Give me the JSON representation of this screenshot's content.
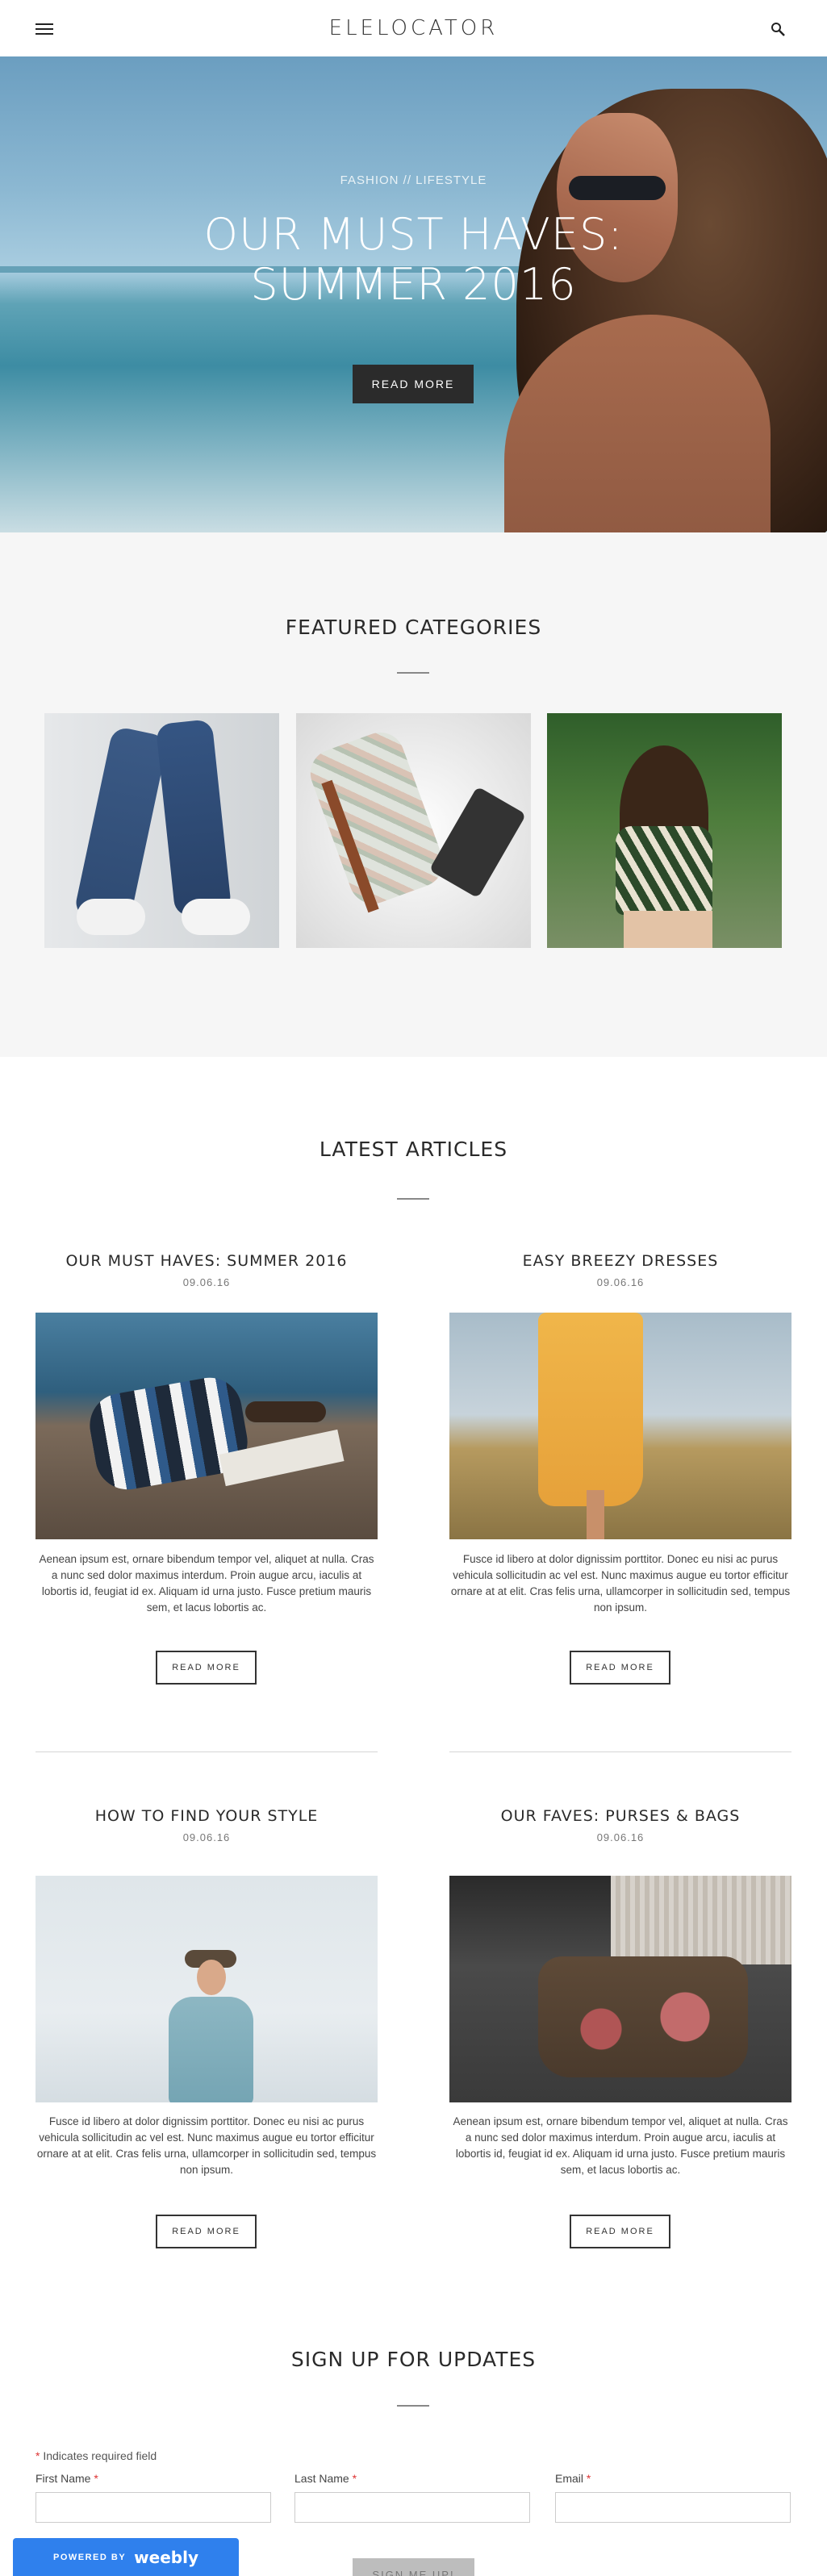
{
  "header": {
    "logo": "ELELOCATOR"
  },
  "hero": {
    "kicker": "FASHION // LIFESTYLE",
    "title_line1": "OUR MUST HAVES:",
    "title_line2": "SUMMER 2016",
    "button_label": "READ MORE"
  },
  "featured": {
    "title": "FEATURED CATEGORIES"
  },
  "latest": {
    "title": "LATEST ARTICLES",
    "articles": [
      {
        "title": "OUR MUST HAVES: SUMMER 2016",
        "date": "09.06.16",
        "excerpt": "Aenean ipsum est, ornare bibendum tempor vel, aliquet at nulla. Cras a nunc sed dolor maximus interdum. Proin augue arcu, iaculis at lobortis id, feugiat id ex. Aliquam id urna justo. Fusce pretium mauris sem, et lacus lobortis ac.",
        "button_label": "READ MORE"
      },
      {
        "title": "EASY BREEZY DRESSES",
        "date": "09.06.16",
        "excerpt": "Fusce id libero at dolor dignissim porttitor. Donec eu nisi ac purus vehicula sollicitudin ac vel est. Nunc maximus augue eu tortor efficitur ornare at at elit. Cras felis urna, ullamcorper in sollicitudin sed, tempus non ipsum.",
        "button_label": "READ MORE"
      },
      {
        "title": "HOW TO FIND YOUR STYLE",
        "date": "09.06.16",
        "excerpt": "Fusce id libero at dolor dignissim porttitor. Donec eu nisi ac purus vehicula sollicitudin ac vel est. Nunc maximus augue eu tortor efficitur ornare at at elit. Cras felis urna, ullamcorper in sollicitudin sed, tempus non ipsum.",
        "button_label": "READ MORE"
      },
      {
        "title": "OUR FAVES: PURSES & BAGS",
        "date": "09.06.16",
        "excerpt": "Aenean ipsum est, ornare bibendum tempor vel, aliquet at nulla. Cras a nunc sed dolor maximus interdum. Proin augue arcu, iaculis at lobortis id, feugiat id ex. Aliquam id urna justo. Fusce pretium mauris sem, et lacus lobortis ac.",
        "button_label": "READ MORE"
      }
    ]
  },
  "signup": {
    "title": "SIGN UP FOR UPDATES",
    "required_note": "Indicates required field",
    "required_mark": "*",
    "fields": [
      {
        "label": "First Name"
      },
      {
        "label": "Last Name"
      },
      {
        "label": "Email"
      }
    ],
    "button_label": "SIGN ME UP!"
  },
  "badge": {
    "powered_by": "POWERED BY",
    "brand": "weebly"
  },
  "colors": {
    "accent_button": "#2b2b2b",
    "badge_blue": "#2f80ed",
    "required": "#d33333"
  }
}
